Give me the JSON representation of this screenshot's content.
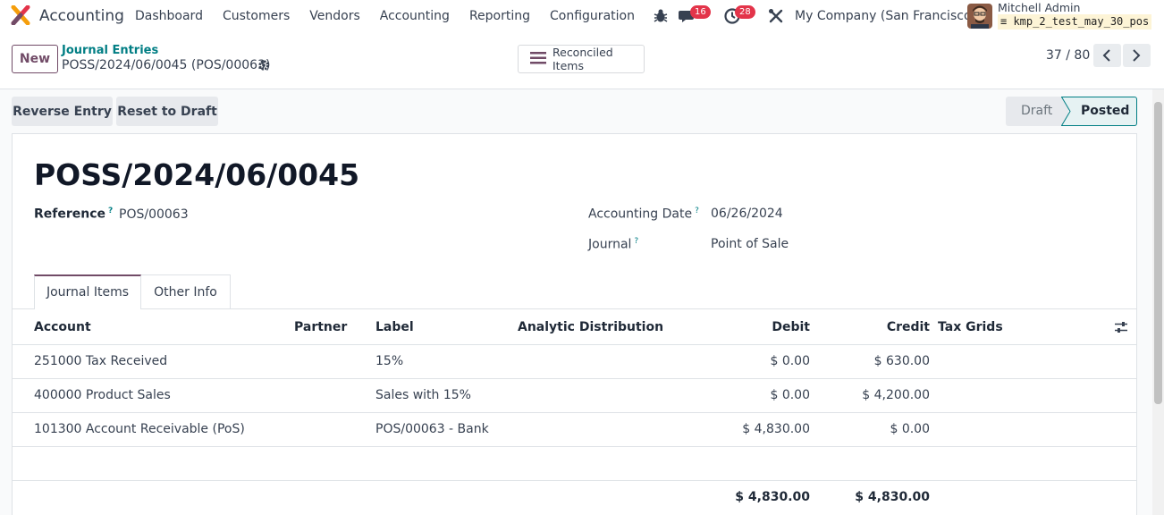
{
  "navbar": {
    "app_name": "Accounting",
    "menu": [
      "Dashboard",
      "Customers",
      "Vendors",
      "Accounting",
      "Reporting",
      "Configuration"
    ],
    "messages_count": "16",
    "activities_count": "28",
    "company": "My Company (San Francisco)",
    "user_name": "Mitchell Admin",
    "database": "kmp_2_test_may_30_pos"
  },
  "control": {
    "new_label": "New",
    "breadcrumb_parent": "Journal Entries",
    "breadcrumb_current": "POSS/2024/06/0045 (POS/00063)",
    "reconciled_label": "Reconciled Items",
    "pager": "37 / 80"
  },
  "actions": {
    "reverse_label": "Reverse Entry",
    "reset_label": "Reset to Draft"
  },
  "status": {
    "draft": "Draft",
    "posted": "Posted",
    "current": "Posted"
  },
  "form": {
    "title": "POSS/2024/06/0045",
    "reference_label": "Reference",
    "reference_value": "POS/00063",
    "accounting_date_label": "Accounting Date",
    "accounting_date_value": "06/26/2024",
    "journal_label": "Journal",
    "journal_value": "Point of Sale",
    "help_marker": "?"
  },
  "tabs": [
    "Journal Items",
    "Other Info"
  ],
  "table": {
    "headers": {
      "account": "Account",
      "partner": "Partner",
      "label": "Label",
      "analytic": "Analytic Distribution",
      "debit": "Debit",
      "credit": "Credit",
      "tax_grids": "Tax Grids"
    },
    "rows": [
      {
        "account": "251000 Tax Received",
        "partner": "",
        "label": "15%",
        "debit": "$ 0.00",
        "credit": "$ 630.00"
      },
      {
        "account": "400000 Product Sales",
        "partner": "",
        "label": "Sales with 15%",
        "debit": "$ 0.00",
        "credit": "$ 4,200.00"
      },
      {
        "account": "101300 Account Receivable (PoS)",
        "partner": "",
        "label": "POS/00063 - Bank",
        "debit": "$ 4,830.00",
        "credit": "$ 0.00"
      }
    ],
    "total_debit": "$ 4,830.00",
    "total_credit": "$ 4,830.00"
  },
  "colors": {
    "brand": "#714b67",
    "link": "#017e84",
    "badge": "#e3344a"
  }
}
